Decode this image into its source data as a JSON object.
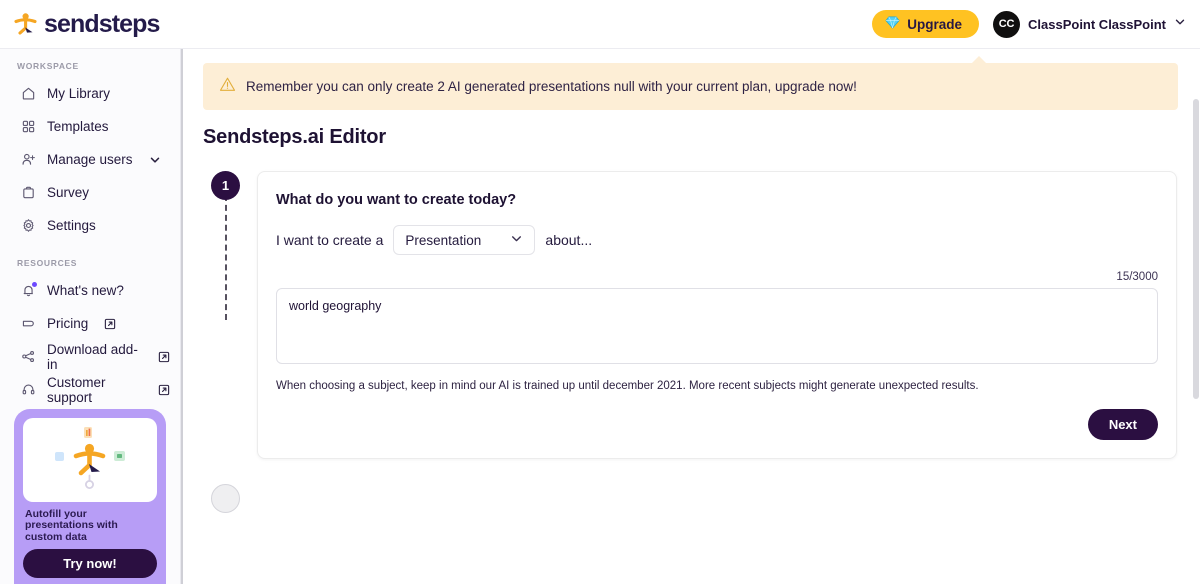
{
  "topbar": {
    "brand_name": "sendsteps",
    "brand_icon": "sendsteps-mascot-logo",
    "upgrade_label": "Upgrade",
    "upgrade_icon": "diamond-gem-icon",
    "upgrade_bg": "#ffc222",
    "avatar_initials": "CC",
    "user_name": "ClassPoint ClassPoint",
    "chevron_icon": "chevron-down-icon"
  },
  "sidebar": {
    "workspace_label": "WORKSPACE",
    "resources_label": "RESOURCES",
    "workspace_items": [
      {
        "label": "My Library",
        "icon": "home-icon",
        "external": false,
        "caret": false,
        "dot": false
      },
      {
        "label": "Templates",
        "icon": "grid-icon",
        "external": false,
        "caret": false,
        "dot": false
      },
      {
        "label": "Manage users",
        "icon": "user-plus-icon",
        "external": false,
        "caret": true,
        "dot": false
      },
      {
        "label": "Survey",
        "icon": "clipboard-icon",
        "external": false,
        "caret": false,
        "dot": false
      },
      {
        "label": "Settings",
        "icon": "gear-icon",
        "external": false,
        "caret": false,
        "dot": false
      }
    ],
    "resources_items": [
      {
        "label": "What's new?",
        "icon": "bell-icon",
        "external": false,
        "caret": false,
        "dot": true
      },
      {
        "label": "Pricing",
        "icon": "tag-icon",
        "external": true,
        "caret": false,
        "dot": false
      },
      {
        "label": "Download add-in",
        "icon": "share-nodes-icon",
        "external": true,
        "caret": false,
        "dot": false
      },
      {
        "label": "Customer support",
        "icon": "headset-icon",
        "external": true,
        "caret": false,
        "dot": false
      }
    ],
    "promo": {
      "text": "Autofill your presentations with custom data",
      "button_label": "Try now!",
      "bg_color": "#b79df6",
      "image_icon": "sendsteps-mascot-data-illustration"
    }
  },
  "main": {
    "alert": {
      "icon": "warning-triangle-icon",
      "text": "Remember you can only create 2 AI generated presentations null with your current plan, upgrade now!",
      "bg_color": "#fdeed6"
    },
    "page_title": "Sendsteps.ai Editor",
    "step_current": "1",
    "card": {
      "question": "What do you want to create today?",
      "prefix_label": "I want to create a",
      "select_value": "Presentation",
      "select_icon": "chevron-down-icon",
      "suffix_label": "about...",
      "counter": "15/3000",
      "textarea_value": "world geography",
      "textarea_placeholder": "",
      "hint": "When choosing a subject, keep in mind our AI is trained up until december 2021. More recent subjects might generate unexpected results.",
      "next_label": "Next"
    }
  }
}
